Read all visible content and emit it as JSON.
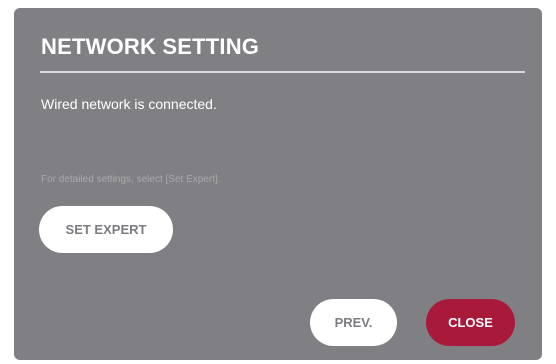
{
  "dialog": {
    "title": "NETWORK SETTING",
    "status": "Wired network is connected.",
    "hint": "For detailed settings, select [Set Expert].",
    "buttons": {
      "set_expert": "SET EXPERT",
      "prev": "PREV.",
      "close": "CLOSE"
    }
  },
  "colors": {
    "panel_background": "#808084",
    "accent_close": "#a8193a",
    "button_light": "#ffffff"
  }
}
